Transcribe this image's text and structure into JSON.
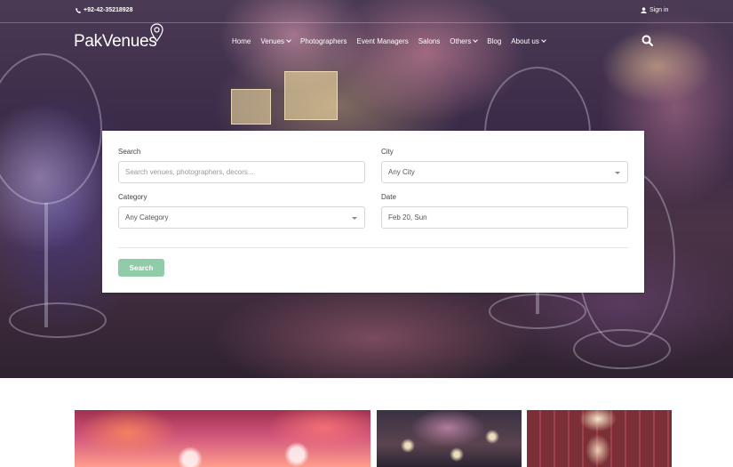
{
  "topbar": {
    "phone": "+92-42-35218928",
    "signin": "Sign in"
  },
  "brand": {
    "logo": "PakVenues"
  },
  "nav": {
    "items": [
      {
        "label": "Home",
        "dropdown": false
      },
      {
        "label": "Venues",
        "dropdown": true
      },
      {
        "label": "Photographers",
        "dropdown": false
      },
      {
        "label": "Event Managers",
        "dropdown": false
      },
      {
        "label": "Salons",
        "dropdown": false
      },
      {
        "label": "Others",
        "dropdown": true
      },
      {
        "label": "Blog",
        "dropdown": false
      },
      {
        "label": "About us",
        "dropdown": true
      }
    ],
    "search_icon": "search-icon"
  },
  "search": {
    "search_label": "Search",
    "search_placeholder": "Search venues, photographers, decors...",
    "city_label": "City",
    "city_value": "Any City",
    "category_label": "Category",
    "category_value": "Any Category",
    "date_label": "Date",
    "date_value": "Feb 20, Sun",
    "submit_label": "Search",
    "submit_color": "#8fcca7"
  }
}
